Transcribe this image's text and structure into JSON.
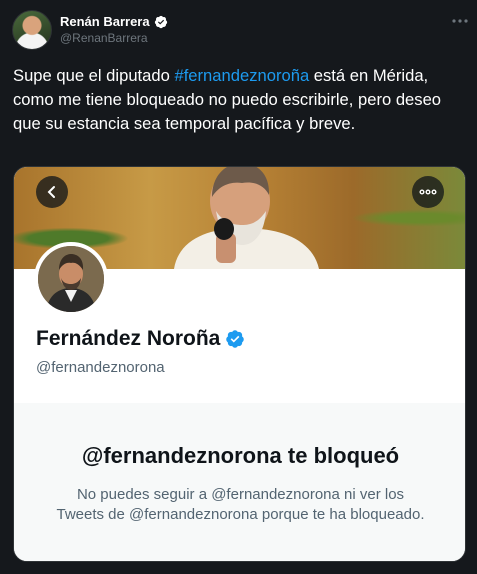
{
  "tweet": {
    "author_name": "Renán Barrera",
    "author_handle": "@RenanBarrera",
    "text_before": "Supe que el diputado ",
    "hashtag": "#fernandeznoroña",
    "text_after": " está en Mérida, como me tiene bloqueado no puedo escribirle, pero deseo que su estancia sea temporal pacífica y breve."
  },
  "card": {
    "profile_name": "Fernández Noroña",
    "profile_handle": "@fernandeznorona",
    "blocked_title": "@fernandeznorona te bloqueó",
    "blocked_desc": "No puedes seguir a @fernandeznorona ni ver los Tweets de @fernandeznorona porque te ha bloqueado."
  },
  "colors": {
    "background": "#15181c",
    "link": "#1d9bf0",
    "verified": "#1d9bf0",
    "card_panel": "#f7f9f9"
  },
  "icons": [
    "verified-badge-icon",
    "more-icon",
    "back-arrow-icon"
  ]
}
